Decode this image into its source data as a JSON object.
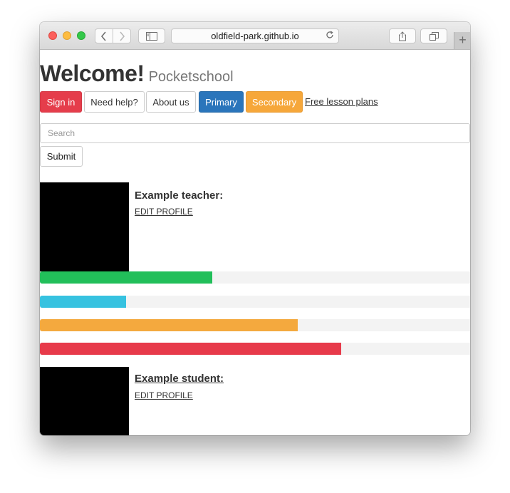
{
  "browser": {
    "url": "oldfield-park.github.io",
    "icons": {
      "back": "chevron-left-icon",
      "forward": "chevron-right-icon",
      "sidebar": "sidebar-icon",
      "reload": "reload-icon",
      "share": "share-icon",
      "tabs": "tabs-icon",
      "new_tab": "plus-icon"
    },
    "new_tab_glyph": "+"
  },
  "page": {
    "title": "Welcome!",
    "subtitle": "Pocketschool"
  },
  "nav": {
    "sign_in": "Sign in",
    "need_help": "Need help?",
    "about_us": "About us",
    "primary": "Primary",
    "secondary": "Secondary",
    "free_lesson_plans": "Free lesson plans"
  },
  "search": {
    "placeholder": "Search",
    "value": "",
    "submit_label": "Submit"
  },
  "teacher": {
    "name": "Example teacher:",
    "edit_label": "EDIT PROFILE"
  },
  "progress_bars": [
    {
      "value": 0.4,
      "color": "#22bf5a"
    },
    {
      "value": 0.2,
      "color": "#36c2e0"
    },
    {
      "value": 0.6,
      "color": "#f4a93e"
    },
    {
      "value": 0.7,
      "color": "#e73a4a"
    }
  ],
  "student": {
    "name": "Example student:",
    "edit_label": "EDIT PROFILE"
  },
  "colors": {
    "danger": "#e53d4b",
    "primary": "#2a75bb",
    "warning": "#f6a73a"
  }
}
